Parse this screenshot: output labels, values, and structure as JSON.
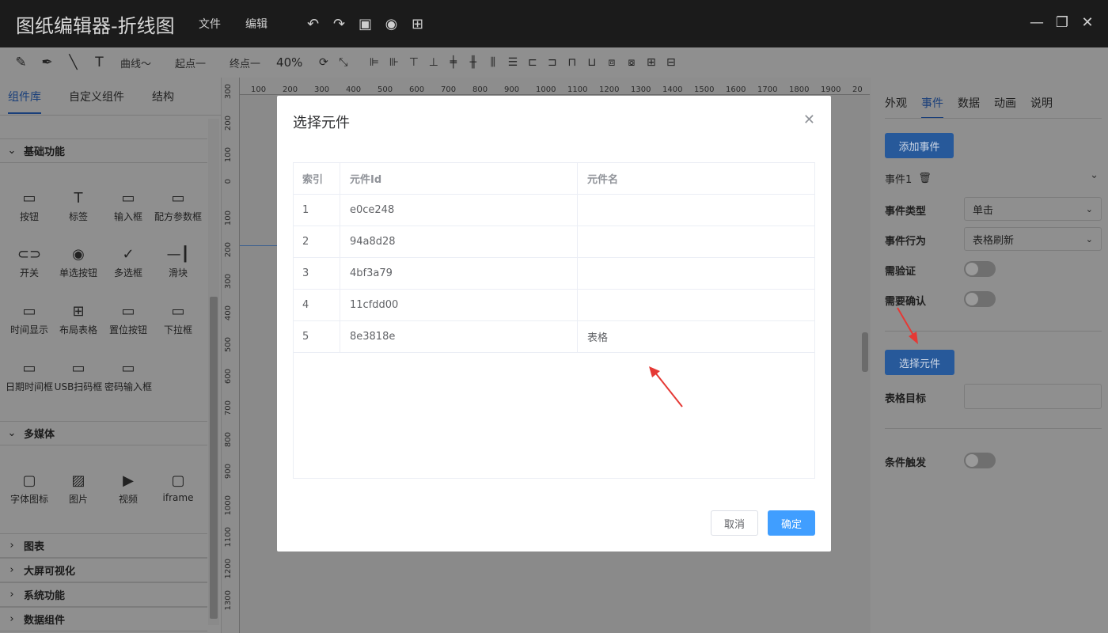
{
  "titlebar": {
    "title": "图纸编辑器-折线图",
    "menu": [
      "文件",
      "编辑"
    ],
    "icons": [
      "undo-icon",
      "redo-icon",
      "save-icon",
      "eye-icon",
      "chip-icon"
    ],
    "window_controls": [
      "minimize-icon",
      "restore-icon",
      "close-icon"
    ]
  },
  "toolbar": {
    "curve": "曲线～",
    "start": "起点一",
    "end": "终点一",
    "zoom": "40%"
  },
  "left_panel": {
    "tabs": [
      "组件库",
      "自定义组件",
      "结构"
    ],
    "sections": {
      "basic": "基础功能",
      "media": "多媒体",
      "chart": "图表",
      "bigscreen": "大屏可视化",
      "system": "系统功能",
      "data": "数据组件"
    },
    "basic_items": [
      "按钮",
      "标签",
      "输入框",
      "配方参数框",
      "开关",
      "单选按钮",
      "多选框",
      "滑块",
      "时间显示",
      "布局表格",
      "置位按钮",
      "下拉框",
      "日期时间框",
      "USB扫码框",
      "密码输入框"
    ],
    "media_items": [
      "字体图标",
      "图片",
      "视频",
      "iframe"
    ]
  },
  "ruler": {
    "top": [
      "100",
      "200",
      "300",
      "400",
      "500",
      "600",
      "700",
      "800",
      "900",
      "1000",
      "1100",
      "1200",
      "1300",
      "1400",
      "1500",
      "1600",
      "1700",
      "1800",
      "1900",
      "20"
    ],
    "left": [
      "300",
      "200",
      "100",
      "0",
      "100",
      "200",
      "300",
      "400",
      "500",
      "600",
      "700",
      "800",
      "900",
      "1000",
      "1100",
      "1200",
      "1300"
    ]
  },
  "right_panel": {
    "tabs": [
      "外观",
      "事件",
      "数据",
      "动画",
      "说明"
    ],
    "add_event": "添加事件",
    "event_name": "事件1",
    "event_type_label": "事件类型",
    "event_type_value": "单击",
    "event_action_label": "事件行为",
    "event_action_value": "表格刷新",
    "need_verify": "需验证",
    "need_confirm": "需要确认",
    "select_component": "选择元件",
    "table_target": "表格目标",
    "condition_trigger": "条件触发"
  },
  "modal": {
    "title": "选择元件",
    "columns": [
      "索引",
      "元件Id",
      "元件名"
    ],
    "rows": [
      [
        "1",
        "e0ce248",
        ""
      ],
      [
        "2",
        "94a8d28",
        ""
      ],
      [
        "3",
        "4bf3a79",
        ""
      ],
      [
        "4",
        "11cfdd00",
        ""
      ],
      [
        "5",
        "8e3818e",
        "表格"
      ]
    ],
    "cancel": "取消",
    "ok": "确定"
  }
}
